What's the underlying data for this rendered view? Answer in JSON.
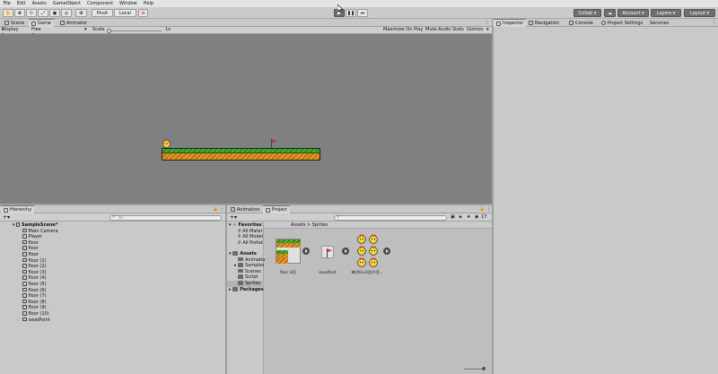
{
  "menu": [
    "File",
    "Edit",
    "Assets",
    "GameObject",
    "Component",
    "Window",
    "Help"
  ],
  "toolbar": {
    "pivot": "Pivot",
    "local": "Local",
    "collab": "Collab",
    "account": "Account",
    "layers": "Layers",
    "layout": "Layout"
  },
  "center_tabs": [
    "Scene",
    "Game",
    "Animator"
  ],
  "game_bar": {
    "display": "Display 1",
    "aspect": "Free Aspect",
    "scale_label": "Scale",
    "scale_value": "1x",
    "maximize": "Maximize On Play",
    "mute": "Mute Audio",
    "stats": "Stats",
    "gizmos": "Gizmos"
  },
  "right_tabs": [
    "Inspector",
    "Navigation",
    "Console",
    "Project Settings",
    "Services"
  ],
  "hierarchy": {
    "tab": "Hierarchy",
    "search_placeholder": "All",
    "scene": "SampleScene*",
    "items": [
      "Main Camera",
      "Player",
      "floor",
      "floor",
      "floor",
      "floor (1)",
      "floor (2)",
      "floor (3)",
      "floor (4)",
      "floor (5)",
      "floor (6)",
      "floor (7)",
      "floor (8)",
      "floor (9)",
      "floor (10)",
      "savePoint"
    ]
  },
  "bottom_tabs": [
    "Animation",
    "Project"
  ],
  "project": {
    "favorites": "Favorites",
    "fav_items": [
      "All Mater",
      "All Model",
      "All Prefat"
    ],
    "assets": "Assets",
    "asset_folders": [
      "Animatio",
      "Samples",
      "Scenes",
      "Script",
      "Sprites"
    ],
    "packages": "Packages",
    "breadcrumb_root": "Assets",
    "breadcrumb_sep": ">",
    "breadcrumb_leaf": "Sprites",
    "count": "17",
    "files": [
      "floor 모음",
      "savePoint",
      "빠야야노모음(수정..."
    ]
  }
}
